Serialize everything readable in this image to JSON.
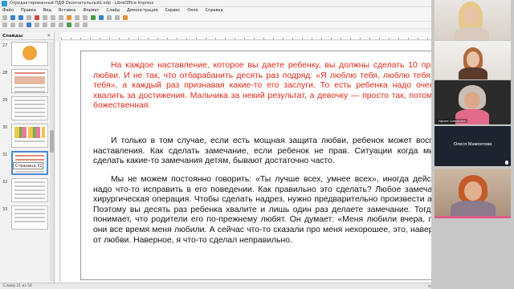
{
  "window": {
    "title": "Отредактированный ПДФ Окончательный1.odp - LibreOffice Impress",
    "controls": "— ▢ ✕"
  },
  "menu": [
    "Файл",
    "Правка",
    "Вид",
    "Вставка",
    "Формат",
    "Слайд",
    "Демонстрация",
    "Сервис",
    "Окно",
    "Справка"
  ],
  "slides_panel": {
    "title": "Слайды",
    "close": "✕",
    "numbers": [
      "27",
      "28",
      "29",
      "30",
      "31",
      "32",
      "33"
    ],
    "tooltip": "Страница 31"
  },
  "slide": {
    "paragraph_red": "На каждое наставление, которое вы даете ребенку, вы должны сделать 10 признаний в любви. И не так, что отбарабанить десять раз подряд: «Я люблю тебя, люблю тебя, я люблю тебя», а каждый раз признавая какие-то его заслуги. То есть ребенка надо очень сильно хвалить за достижения. Мальчика за некий результат, а девочку — просто так, потому, что она божественная.",
    "paragraph_2": "И только в том случае, если есть мощная защита любви, ребенок может воспринимать наставления. Как сделать замечание, если ребенок не прав. Ситуации когда мы должны сделать какие-то замечания детям, бывают достаточно часто.",
    "paragraph_3": "Мы не можем постоянно говорить: «Ты лучше всех, умнее всех», иногда действительно надо что-то исправить в его поведении. Как правильно это сделать? Любое замечание – это хирургическая операция. Чтобы сделать надрез, нужно предварительно произвести анестезию. Поэтому вы десять раз ребенка хвалите и лишь один раз делаете замечание. Тогда ребенок понимает, что родители его по-прежнему любят. Он думает: «Меня любили вчера, позавчера, они все время меня любили. А сейчас что-то сказали про меня нехорошее, это, наверное, тоже от любви. Наверное, я что-то сделал неправильно."
  },
  "statusbar": {
    "text": "Слайд 31 из 54"
  },
  "video_call": {
    "participants": [
      {
        "name": ""
      },
      {
        "name": ""
      },
      {
        "name": "Ирина Синицина"
      },
      {
        "name": "Олеся Мамонтова"
      },
      {
        "name": ""
      }
    ]
  }
}
